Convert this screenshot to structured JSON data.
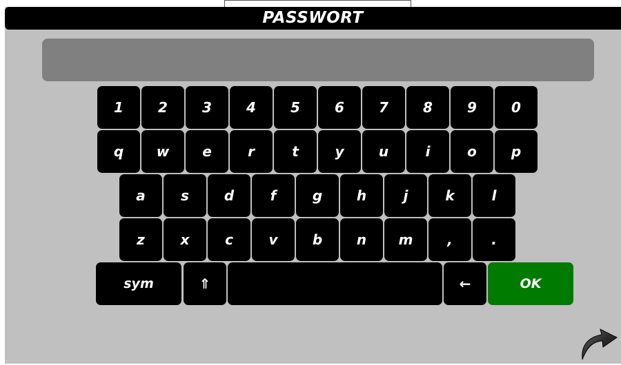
{
  "title": "PASSWORT",
  "password_field": {
    "value": ""
  },
  "keyboard": {
    "row1": [
      "1",
      "2",
      "3",
      "4",
      "5",
      "6",
      "7",
      "8",
      "9",
      "0"
    ],
    "row2": [
      "q",
      "w",
      "e",
      "r",
      "t",
      "y",
      "u",
      "i",
      "o",
      "p"
    ],
    "row3": [
      "a",
      "s",
      "d",
      "f",
      "g",
      "h",
      "j",
      "k",
      "l"
    ],
    "row4": [
      "z",
      "x",
      "c",
      "v",
      "b",
      "n",
      "m",
      ",",
      "."
    ],
    "sym_label": "sym",
    "shift_label": "⇑",
    "space_label": "",
    "backspace_label": "←",
    "ok_label": "OK"
  },
  "icons": {
    "shift": "shift-arrow-icon",
    "backspace": "backspace-arrow-icon",
    "back": "curved-back-arrow-icon"
  },
  "colors": {
    "background": "#c0c0c0",
    "key": "#000000",
    "ok_key": "#007b00",
    "password_field": "#808080"
  }
}
